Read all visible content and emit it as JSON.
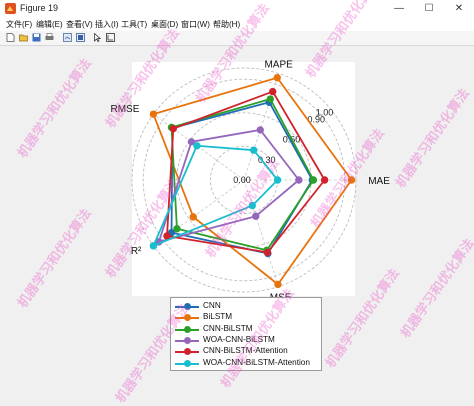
{
  "window": {
    "title": "Figure 19",
    "minimize_symbol": "—",
    "maximize_symbol": "☐",
    "close_symbol": "✕"
  },
  "menu": {
    "items": [
      "文件(F)",
      "编辑(E)",
      "查看(V)",
      "插入(I)",
      "工具(T)",
      "桌面(D)",
      "窗口(W)",
      "帮助(H)"
    ]
  },
  "toolbar": {
    "icons": [
      "new-file-icon",
      "open-folder-icon",
      "save-icon",
      "print-icon",
      "link-plot-icon",
      "dock-icon",
      "pointer-icon",
      "edit-plot-icon"
    ]
  },
  "watermark": {
    "text": "机器学习和优化算法",
    "color": "#eb50c8"
  },
  "chart_data": {
    "type": "radar",
    "axes": [
      "MAE",
      "MAPE",
      "RMSE",
      "R²",
      "MSE"
    ],
    "range": [
      0,
      1.0
    ],
    "ring_values": [
      0.3,
      0.6,
      0.9,
      1.0
    ],
    "ring_labels": [
      "0.00",
      "0.30",
      "0.60",
      "0.90",
      "1.00"
    ],
    "grid": true,
    "legend_position": "below",
    "series": [
      {
        "name": "CNN",
        "color": "#1f6db5",
        "values": [
          0.61,
          0.73,
          0.79,
          0.8,
          0.69
        ]
      },
      {
        "name": "BiLSTM",
        "color": "#e8730c",
        "values": [
          0.96,
          0.96,
          1.0,
          0.56,
          0.98
        ]
      },
      {
        "name": "CNN-BiLSTM",
        "color": "#2aa02a",
        "values": [
          0.62,
          0.76,
          0.8,
          0.74,
          0.66
        ]
      },
      {
        "name": "WOA-CNN-BiLSTM",
        "color": "#9467bd",
        "values": [
          0.49,
          0.47,
          0.58,
          0.94,
          0.34
        ]
      },
      {
        "name": "CNN-BiLSTM-Attention",
        "color": "#d0222b",
        "values": [
          0.72,
          0.83,
          0.78,
          0.85,
          0.68
        ]
      },
      {
        "name": "WOA-CNN-BiLSTM-Attention",
        "color": "#17becf",
        "values": [
          0.3,
          0.28,
          0.52,
          1.0,
          0.24
        ]
      }
    ]
  }
}
